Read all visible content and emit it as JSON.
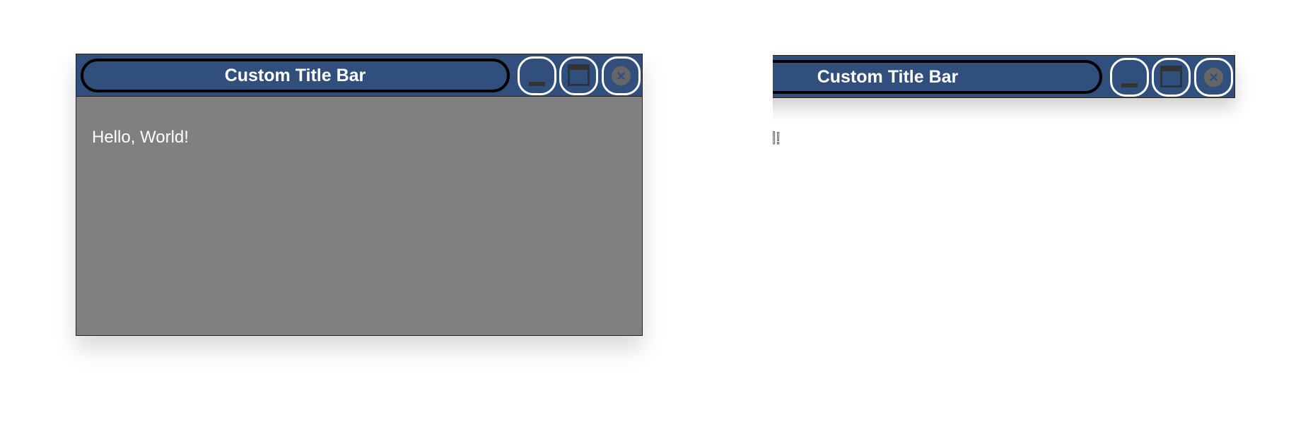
{
  "windows": [
    {
      "title": "Custom Title Bar",
      "content": "Hello, World!",
      "body_color": "#808080"
    },
    {
      "title": "Custom Title Bar",
      "content": "Hello, World!",
      "body_color": "transparent"
    }
  ],
  "buttons": {
    "minimize_icon": "minimize-icon",
    "maximize_icon": "maximize-icon",
    "close_icon": "close-icon",
    "close_glyph": "×"
  },
  "colors": {
    "titlebar": "#314f7c",
    "button_border": "#ffffff",
    "icon": "#333333"
  }
}
